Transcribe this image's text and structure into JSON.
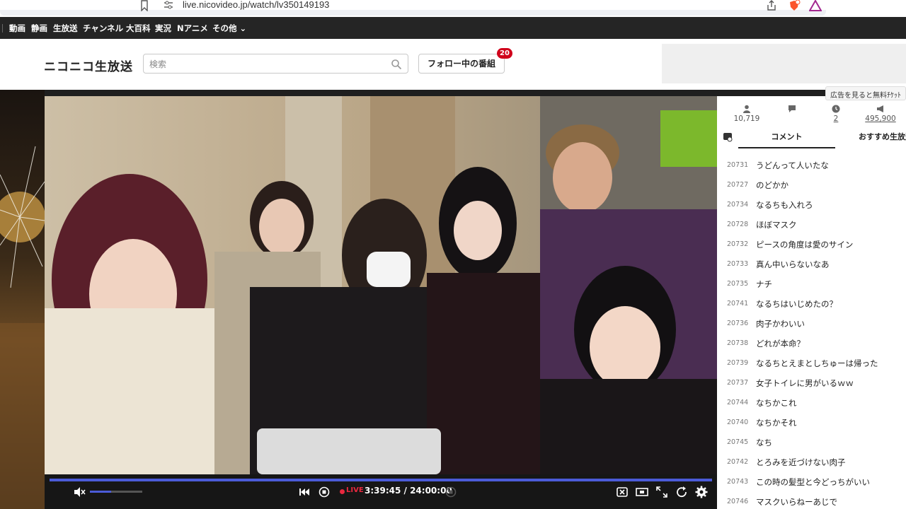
{
  "browser": {
    "url": "live.nicovideo.jp/watch/lv350149193",
    "icons": [
      "bookmark-icon",
      "site-info-icon",
      "share-icon",
      "brave-shield-icon",
      "brave-rewards-icon"
    ]
  },
  "global_nav": {
    "items": [
      "動画",
      "静画",
      "生放送",
      "チャンネル",
      "大百科",
      "実況",
      "Nアニメ",
      "その他"
    ]
  },
  "header": {
    "logo": "ニコニコ生放送",
    "search_placeholder": "検索",
    "follow_button": "フォロー中の番組",
    "follow_badge": "20"
  },
  "ad_tooltip": "広告を見ると無料ﾁｹｯﾄ",
  "stats": {
    "viewers": "10,719",
    "comments_icon": "comment-icon",
    "timeshift": "2",
    "ad_points": "495,900"
  },
  "tabs": {
    "comment": "コメント",
    "recommend": "おすすめ生放送"
  },
  "comments": [
    {
      "no": "20731",
      "text": "うどんって人いたな"
    },
    {
      "no": "20727",
      "text": "のどかか"
    },
    {
      "no": "20734",
      "text": "なるちも入れろ"
    },
    {
      "no": "20728",
      "text": "ほぼマスク"
    },
    {
      "no": "20732",
      "text": "ピースの角度は愛のサイン"
    },
    {
      "no": "20733",
      "text": "真ん中いらないなあ"
    },
    {
      "no": "20735",
      "text": "ナチ"
    },
    {
      "no": "20741",
      "text": "なるちはいじめたの？"
    },
    {
      "no": "20736",
      "text": "肉子かわいい"
    },
    {
      "no": "20738",
      "text": "どれが本命？"
    },
    {
      "no": "20739",
      "text": "なるちとえまとしちゅーは帰った"
    },
    {
      "no": "20737",
      "text": "女子トイレに男がいるｗｗ"
    },
    {
      "no": "20744",
      "text": "なちかこれ"
    },
    {
      "no": "20740",
      "text": "なちかそれ"
    },
    {
      "no": "20745",
      "text": "なち"
    },
    {
      "no": "20742",
      "text": "とろみを近づけない肉子"
    },
    {
      "no": "20743",
      "text": "この時の髪型と今どっちがいい"
    },
    {
      "no": "20746",
      "text": "マスクいらねーあじで"
    }
  ],
  "player": {
    "live_label": "LIVE",
    "time": "3:39:45 / 24:00:00",
    "volume_fraction": 0.4,
    "progress_fraction": 1.0,
    "accent": "#4b5bd8",
    "live_color": "#e8283f"
  },
  "video": {
    "description_icon": "live-stream-video"
  }
}
